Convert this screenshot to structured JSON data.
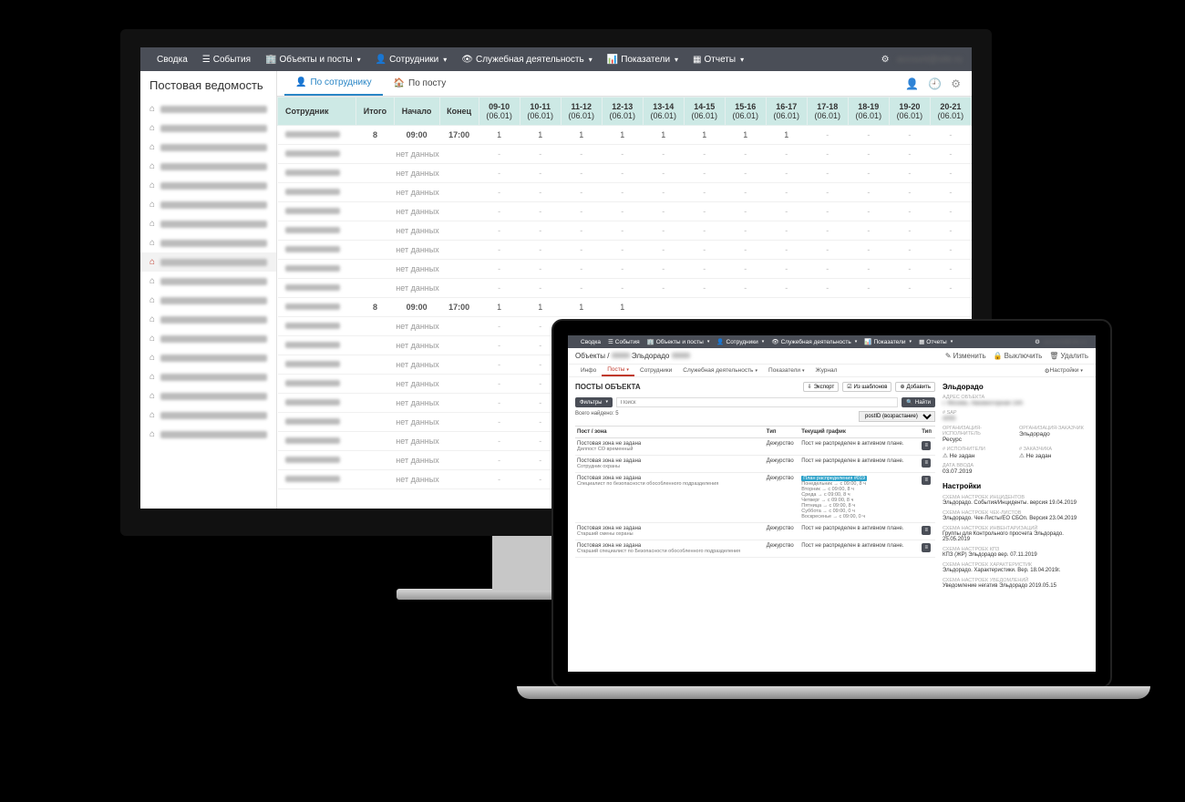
{
  "nav": {
    "items": [
      "Сводка",
      "События",
      "Объекты и посты",
      "Сотрудники",
      "Служебная деятельность",
      "Показатели",
      "Отчеты"
    ],
    "account": "account@site.ru"
  },
  "desktop": {
    "sidebar_title": "Постовая ведомость",
    "sidebar_active_index": 8,
    "tabs": {
      "by_employee": "По сотруднику",
      "by_post": "По посту"
    },
    "table": {
      "header": {
        "employee": "Сотрудник",
        "total": "Итого",
        "start": "Начало",
        "end": "Конец",
        "slots": [
          "09-10",
          "10-11",
          "11-12",
          "12-13",
          "13-14",
          "14-15",
          "15-16",
          "16-17",
          "17-18",
          "18-19",
          "19-20",
          "20-21"
        ],
        "sub": "(06.01)"
      },
      "no_data": "нет данных",
      "rows": [
        {
          "total": "8",
          "start": "09:00",
          "end": "17:00",
          "slots": [
            1,
            1,
            1,
            1,
            1,
            1,
            1,
            1,
            "-",
            "-",
            "-",
            "-"
          ]
        },
        {
          "nodata": true
        },
        {
          "nodata": true
        },
        {
          "nodata": true
        },
        {
          "nodata": true
        },
        {
          "nodata": true
        },
        {
          "nodata": true
        },
        {
          "nodata": true
        },
        {
          "nodata": true
        },
        {
          "total": "8",
          "start": "09:00",
          "end": "17:00",
          "slots": [
            1,
            1,
            1,
            1,
            "",
            "",
            "",
            "",
            "",
            "",
            "",
            ""
          ]
        },
        {
          "nodata": true
        },
        {
          "nodata": true
        },
        {
          "nodata": true
        },
        {
          "nodata": true
        },
        {
          "nodata": true
        },
        {
          "nodata": true
        },
        {
          "nodata": true
        },
        {
          "nodata": true
        },
        {
          "nodata": true
        }
      ]
    }
  },
  "laptop": {
    "breadcrumb": {
      "root": "Объекты",
      "current": "Эльдорадо"
    },
    "actions": {
      "edit": "Изменить",
      "disable": "Выключить",
      "del": "Удалить"
    },
    "tabs": [
      "Инфо",
      "Посты",
      "Сотрудники",
      "Служебная деятельность",
      "Показатели",
      "Журнал"
    ],
    "tabs_right": "Настройки",
    "panel_title": "ПОСТЫ ОБЪЕКТА",
    "topbtn": {
      "export": "Экспорт",
      "template": "Из шаблонов",
      "add": "Добавить"
    },
    "filter_btn": "Фильтры",
    "search_placeholder": "Поиск",
    "find_btn": "Найти",
    "total_found": "Всего найдено: 5",
    "sort": "postID (возрастание)",
    "table": {
      "head": {
        "zone": "Пост / зона",
        "type": "Тип",
        "schedule": "Текущий график",
        "t2": "Тип"
      },
      "rows": [
        {
          "zone": "Постовая зона не задана",
          "role": "Дилпост СО временный",
          "type": "Дежурство",
          "sch": "Пост не распределен в активном плане."
        },
        {
          "zone": "Постовая зона не задана",
          "role": "Сотрудник охраны",
          "type": "Дежурство",
          "sch": "Пост не распределен в активном плане."
        },
        {
          "zone": "Постовая зона не задана",
          "role": "Специалист по безопасности обособленного подразделения",
          "type": "Дежурство",
          "plan": "План распределения #019",
          "days": [
            "Понедельник → с 09:00, 8 ч",
            "Вторник → с 09:00, 8 ч",
            "Среда → с 09:00, 8 ч",
            "Четверг → с 09:00, 8 ч",
            "Пятница → с 09:00, 8 ч",
            "Суббота → с 09:00, 0 ч",
            "Воскресенье → с 09:00, 0 ч"
          ]
        },
        {
          "zone": "Постовая зона не задана",
          "role": "Старший смены охраны",
          "type": "Дежурство",
          "sch": "Пост не распределен в активном плане."
        },
        {
          "zone": "Постовая зона не задана",
          "role": "Старший специалист по Безопасности обособленного подразделения",
          "type": "Дежурство",
          "sch": "Пост не распределен в активном плане."
        }
      ]
    },
    "info": {
      "title": "Эльдорадо",
      "address_lbl": "АДРЕС ОБЪЕКТА",
      "address_val": "г. Москва, Авиамоторная 14А",
      "sap_lbl": "# SAP",
      "sap_val": "4055",
      "org_exec_lbl": "ОРГАНИЗАЦИЯ-ИСПОЛНИТЕЛЬ",
      "org_exec": "Ресурс",
      "org_cust_lbl": "ОРГАНИЗАЦИЯ-ЗАКАЗЧИК",
      "org_cust": "Эльдорадо",
      "exec_cnt_lbl": "# ИСПОЛНИТЕЛИ",
      "exec_cnt": "Не задан",
      "req_cnt_lbl": "# ЗАКАЗЧИКА",
      "req_cnt": "Не задан",
      "date_lbl": "ДАТА ВВОДА",
      "date": "03.07.2019",
      "settings_title": "Настройки",
      "settings": [
        {
          "lbl": "СХЕМА НАСТРОЕК ИНЦИДЕНТОВ",
          "val": "Эльдорадо. События/Инциденты. версия 19.04.2019"
        },
        {
          "lbl": "СХЕМА НАСТРОЕК ЧЕК-ЛИСТОВ",
          "val": "Эльдорадо. Чек-Листы/ЕО СБОп. Версия 23.04.2019"
        },
        {
          "lbl": "СХЕМА НАСТРОЕК ИНВЕНТАРИЗАЦИЙ",
          "val": "Группы для Контрольного просчета Эльдорадо. 25.05.2019"
        },
        {
          "lbl": "СХЕМА НАСТРОЕК КПЗ",
          "val": "КПЗ (ЖР) Эльдорадо вер. 07.11.2019"
        },
        {
          "lbl": "СХЕМА НАСТРОЕК ХАРАКТЕРИСТИК",
          "val": "Эльдорадо. Характеристики. Вер. 18.04.2019г."
        },
        {
          "lbl": "СХЕМА НАСТРОЕК УВЕДОМЛЕНИЙ",
          "val": "Уведомление негатив Эльдорадо 2019.05.15"
        }
      ]
    }
  }
}
